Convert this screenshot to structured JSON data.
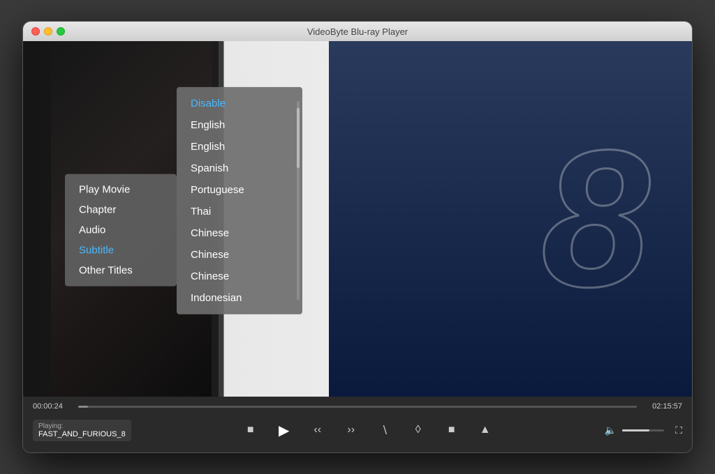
{
  "window": {
    "title": "VideoByte Blu-ray Player"
  },
  "traffic_lights": {
    "red": "red",
    "yellow": "yellow",
    "green": "green"
  },
  "main_menu": {
    "items": [
      {
        "label": "Play Movie",
        "active": false
      },
      {
        "label": "Chapter",
        "active": false
      },
      {
        "label": "Audio",
        "active": false
      },
      {
        "label": "Subtitle",
        "active": true
      },
      {
        "label": "Other Titles",
        "active": false
      }
    ]
  },
  "subtitle_menu": {
    "items": [
      {
        "label": "Disable",
        "active": true
      },
      {
        "label": "English",
        "active": false
      },
      {
        "label": "English",
        "active": false
      },
      {
        "label": "Spanish",
        "active": false
      },
      {
        "label": "Portuguese",
        "active": false
      },
      {
        "label": "Thai",
        "active": false
      },
      {
        "label": "Chinese",
        "active": false
      },
      {
        "label": "Chinese",
        "active": false
      },
      {
        "label": "Chinese",
        "active": false
      },
      {
        "label": "Indonesian",
        "active": false
      }
    ]
  },
  "controls": {
    "time_current": "00:00:24",
    "time_total": "02:15:57",
    "playing_label": "Playing:",
    "playing_title": "FAST_AND_FURIOUS_8",
    "progress_percent": 1.8,
    "volume_percent": 65
  },
  "movie": {
    "number": "8"
  }
}
